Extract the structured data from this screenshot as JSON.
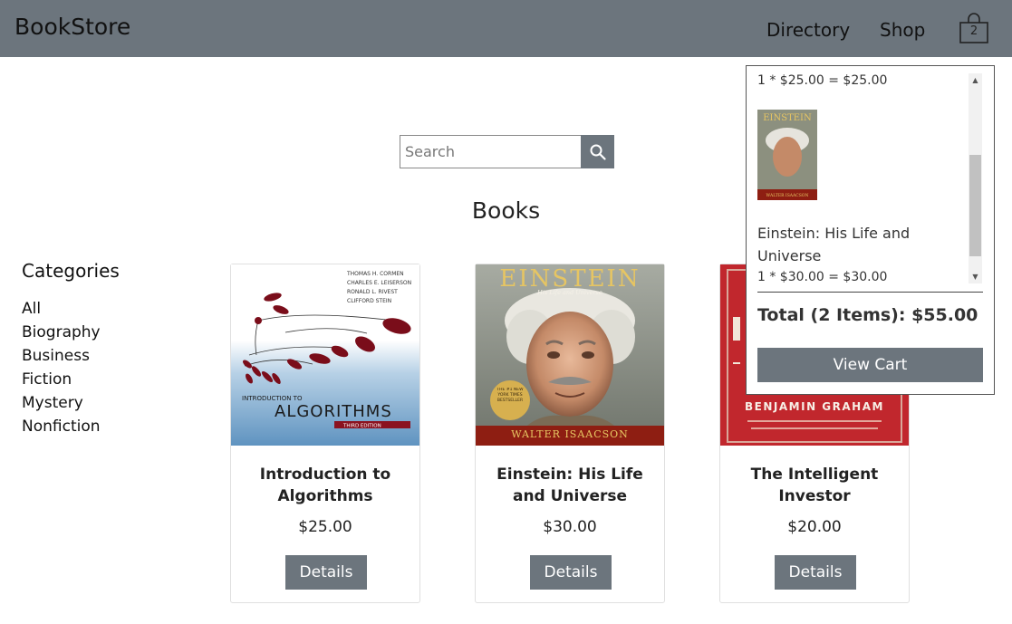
{
  "header": {
    "brand": "BookStore",
    "nav": [
      "Directory",
      "Shop"
    ],
    "cart_count": "2",
    "background": "#6c757d"
  },
  "search": {
    "placeholder": "Search",
    "icon": "search-icon"
  },
  "page_title": "Books",
  "categories": {
    "title": "Categories",
    "items": [
      "All",
      "Biography",
      "Business",
      "Fiction",
      "Mystery",
      "Nonfiction"
    ]
  },
  "books": [
    {
      "title": "Introduction to Algorithms",
      "price": "$25.00",
      "button": "Details",
      "cover": {
        "authors": [
          "THOMAS H. CORMEN",
          "CHARLES E. LEISERSON",
          "RONALD L. RIVEST",
          "CLIFFORD STEIN"
        ],
        "line1": "INTRODUCTION TO",
        "line2": "ALGORITHMS",
        "edition": "THIRD EDITION"
      }
    },
    {
      "title": "Einstein: His Life and Universe",
      "price": "$30.00",
      "button": "Details",
      "cover": {
        "heading": "EINSTEIN",
        "subtitle": "His Life and Universe",
        "badge": "THE #1 NEW YORK TIMES BESTSELLER",
        "author": "WALTER ISAACSON"
      }
    },
    {
      "title": "The Intelligent Investor",
      "price": "$20.00",
      "button": "Details",
      "cover": {
        "author": "BENJAMIN GRAHAM"
      }
    }
  ],
  "cart": {
    "line_prev": "1 * $25.00 = $25.00",
    "item_title": "Einstein: His Life and Universe",
    "item_line": "1 * $30.00 = $30.00",
    "thumb": {
      "heading": "EINSTEIN",
      "author": "WALTER ISAACSON"
    },
    "total": "Total (2 Items): $55.00",
    "button": "View Cart"
  }
}
